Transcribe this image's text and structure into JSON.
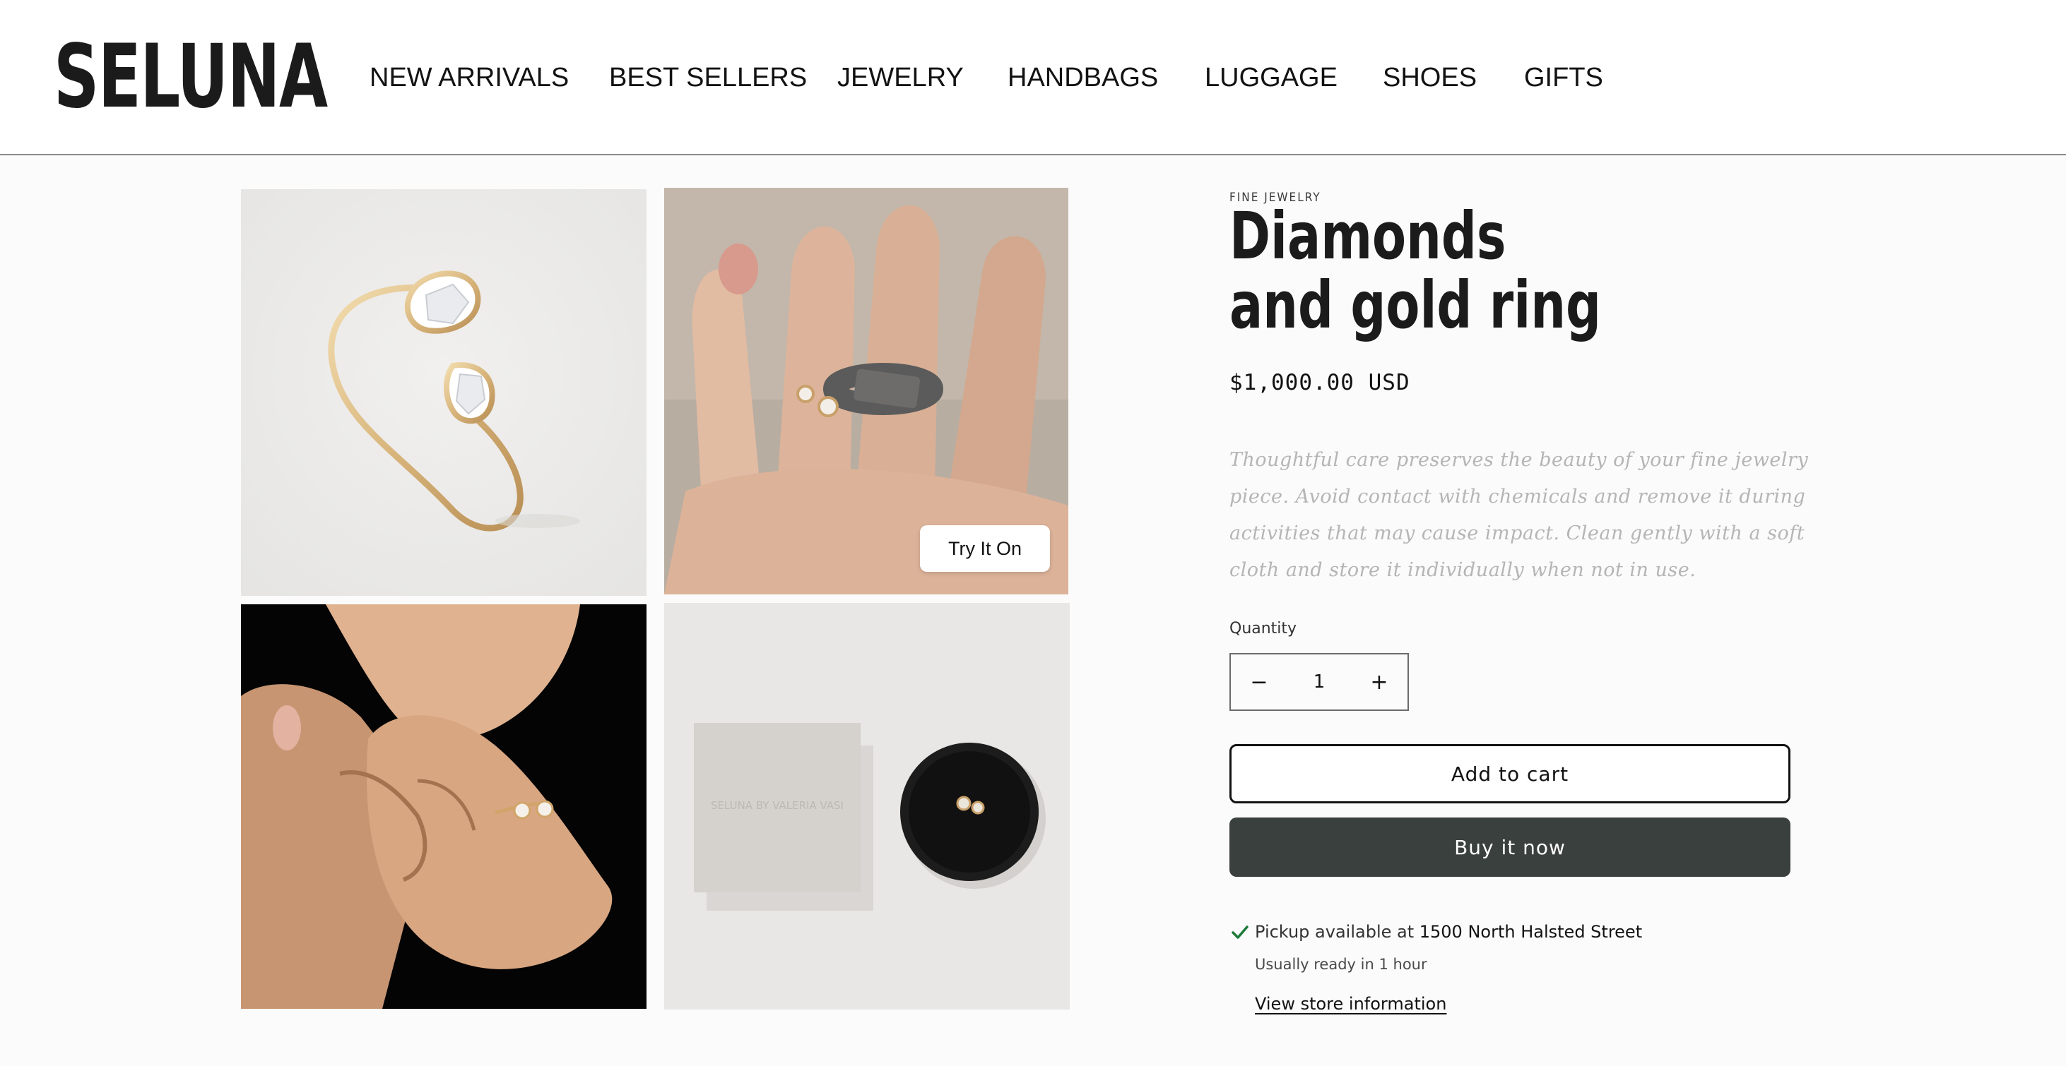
{
  "brand": {
    "logo_text": "SELUNA"
  },
  "nav": {
    "items": [
      "NEW ARRIVALS",
      "BEST SELLERS",
      "JEWELRY",
      "HANDBAGS",
      "LUGGAGE",
      "SHOES",
      "GIFTS"
    ]
  },
  "gallery": {
    "try_on_label": "Try It On",
    "box_lettering": "SELUNA BY VALERIA VASI"
  },
  "product": {
    "category": "FINE JEWELRY",
    "title": "Diamonds and gold ring",
    "price": "$1,000.00 USD",
    "description": "Thoughtful care preserves the beauty of your fine jewelry piece. Avoid contact with chemicals and remove it during activities that may cause impact. Clean gently with a soft cloth and store it individually when not in use."
  },
  "quantity": {
    "label": "Quantity",
    "value": "1",
    "decrement_symbol": "−",
    "increment_symbol": "+"
  },
  "actions": {
    "add_to_cart": "Add to cart",
    "buy_now": "Buy it now"
  },
  "pickup": {
    "prefix": "Pickup available at ",
    "location": "1500 North Halsted Street",
    "ready_text": "Usually ready in 1 hour",
    "store_link": "View store information",
    "status_color": "#1c7a3a"
  },
  "colors": {
    "buy_button_bg": "#3a403d",
    "description_text": "#b5b5b5",
    "page_bg": "#fbfbfb"
  }
}
